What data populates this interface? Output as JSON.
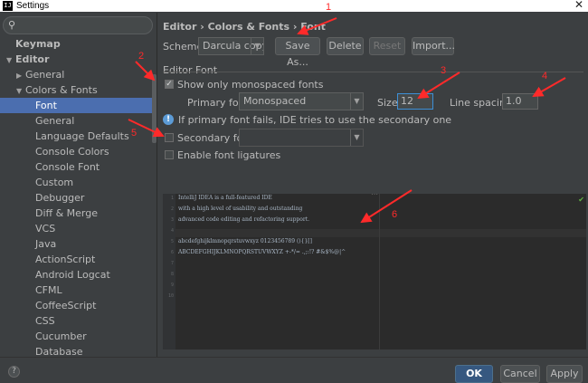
{
  "window": {
    "app_icon": "IJ",
    "title": "Settings",
    "close_glyph": "✕"
  },
  "sidebar": {
    "search_placeholder": "",
    "items": [
      {
        "label": "Keymap",
        "bold": true
      },
      {
        "label": "Editor",
        "bold": true,
        "expanded": true
      },
      {
        "label": "General",
        "collapsed": true
      },
      {
        "label": "Colors & Fonts",
        "expanded": true
      },
      {
        "label": "Font",
        "selected": true
      },
      {
        "label": "General"
      },
      {
        "label": "Language Defaults"
      },
      {
        "label": "Console Colors"
      },
      {
        "label": "Console Font"
      },
      {
        "label": "Custom"
      },
      {
        "label": "Debugger"
      },
      {
        "label": "Diff & Merge"
      },
      {
        "label": "VCS"
      },
      {
        "label": "Java"
      },
      {
        "label": "ActionScript"
      },
      {
        "label": "Android Logcat"
      },
      {
        "label": "CFML"
      },
      {
        "label": "CoffeeScript"
      },
      {
        "label": "CSS"
      },
      {
        "label": "Cucumber"
      },
      {
        "label": "Database"
      }
    ]
  },
  "content": {
    "breadcrumb": "Editor › Colors & Fonts › Font",
    "scheme": {
      "label": "Scheme:",
      "value": "Darcula copy",
      "save_as": "Save As...",
      "delete": "Delete",
      "reset": "Reset",
      "import": "Import..."
    },
    "section_title": "Editor Font",
    "show_monospaced": {
      "label": "Show only monospaced fonts",
      "checked": true
    },
    "primary_font": {
      "label": "Primary font:",
      "value": "Monospaced"
    },
    "size": {
      "label": "Size:",
      "value": "12"
    },
    "line_spacing": {
      "label": "Line spacing:",
      "value": "1.0"
    },
    "info_text": "If primary font fails, IDE tries to use the secondary one",
    "secondary_font": {
      "label": "Secondary font:",
      "value": "",
      "checked": false
    },
    "ligatures": {
      "label": "Enable font ligatures",
      "checked": false
    },
    "preview": {
      "line_numbers": [
        "1",
        "2",
        "3",
        "4",
        "5",
        "6",
        "7",
        "8",
        "9",
        "10"
      ],
      "lines": [
        "IntelliJ IDEA is a full-featured IDE",
        "with a high level of usability and outstanding",
        "advanced code editing and refactoring support.",
        "",
        "abcdefghijklmnopqrstuvwxyz 0123456789 (){}[]",
        "ABCDEFGHIJKLMNOPQRSTUVWXYZ +-*/= .,;:!? #&$%@|^",
        "",
        "",
        "",
        ""
      ]
    }
  },
  "footer": {
    "help": "?",
    "ok": "OK",
    "cancel": "Cancel",
    "apply": "Apply"
  },
  "annotations": [
    "1",
    "2",
    "3",
    "4",
    "5",
    "6"
  ],
  "colors": {
    "background": "#3c3f41",
    "selection": "#4b6eaf",
    "editor_bg": "#2b2b2b",
    "annotation_red": "#ff2a2a",
    "ok_button": "#365880"
  }
}
